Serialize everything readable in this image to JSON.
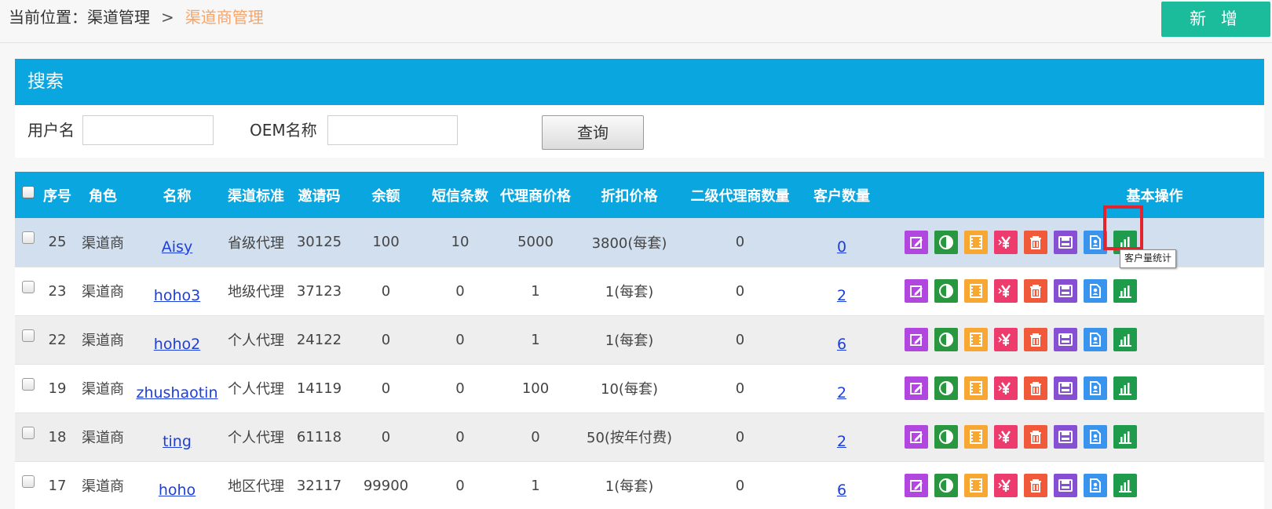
{
  "breadcrumb": {
    "prefix": "当前位置：渠道管理",
    "separator": ">",
    "current": "渠道商管理"
  },
  "toolbar": {
    "add_label": "新 增"
  },
  "search": {
    "title": "搜索",
    "username_label": "用户名",
    "username_value": "",
    "oem_label": "OEM名称",
    "oem_value": "",
    "query_label": "查询"
  },
  "table": {
    "headers": {
      "select": "",
      "id": "序号",
      "role": "角色",
      "name": "名称",
      "standard": "渠道标准",
      "invite": "邀请码",
      "balance": "余额",
      "sms": "短信条数",
      "agent_price": "代理商价格",
      "discount": "折扣价格",
      "sub_agents": "二级代理商数量",
      "customers": "客户数量",
      "ops": "基本操作"
    },
    "rows": [
      {
        "id": "25",
        "role": "渠道商",
        "name": "Aisy",
        "standard": "省级代理",
        "invite": "30125",
        "balance": "100",
        "sms": "10",
        "agent_price": "5000",
        "discount": "3800(每套)",
        "sub_agents": "0",
        "customers": "0"
      },
      {
        "id": "23",
        "role": "渠道商",
        "name": "hoho3",
        "standard": "地级代理",
        "invite": "37123",
        "balance": "0",
        "sms": "0",
        "agent_price": "1",
        "discount": "1(每套)",
        "sub_agents": "0",
        "customers": "2"
      },
      {
        "id": "22",
        "role": "渠道商",
        "name": "hoho2",
        "standard": "个人代理",
        "invite": "24122",
        "balance": "0",
        "sms": "0",
        "agent_price": "1",
        "discount": "1(每套)",
        "sub_agents": "0",
        "customers": "6"
      },
      {
        "id": "19",
        "role": "渠道商",
        "name": "zhushaotin",
        "standard": "个人代理",
        "invite": "14119",
        "balance": "0",
        "sms": "0",
        "agent_price": "100",
        "discount": "10(每套)",
        "sub_agents": "0",
        "customers": "2"
      },
      {
        "id": "18",
        "role": "渠道商",
        "name": "ting",
        "standard": "个人代理",
        "invite": "61118",
        "balance": "0",
        "sms": "0",
        "agent_price": "0",
        "discount": "50(按年付费)",
        "sub_agents": "0",
        "customers": "2"
      },
      {
        "id": "17",
        "role": "渠道商",
        "name": "hoho",
        "standard": "地区代理",
        "invite": "32117",
        "balance": "99900",
        "sms": "0",
        "agent_price": "1",
        "discount": "1(每套)",
        "sub_agents": "0",
        "customers": "6"
      }
    ],
    "op_icons": [
      "edit-icon",
      "toggle-status-icon",
      "media-icon",
      "price-icon",
      "delete-icon",
      "save-icon",
      "customer-stats-icon",
      "chart-icon"
    ]
  },
  "tooltip": {
    "text": "客户量统计"
  },
  "colors": {
    "header_blue": "#0aa6df",
    "add_button": "#1bbc9b",
    "breadcrumb_current": "#f4a56e",
    "highlight_red": "#e5232d",
    "selected_row": "#d1dfee"
  }
}
